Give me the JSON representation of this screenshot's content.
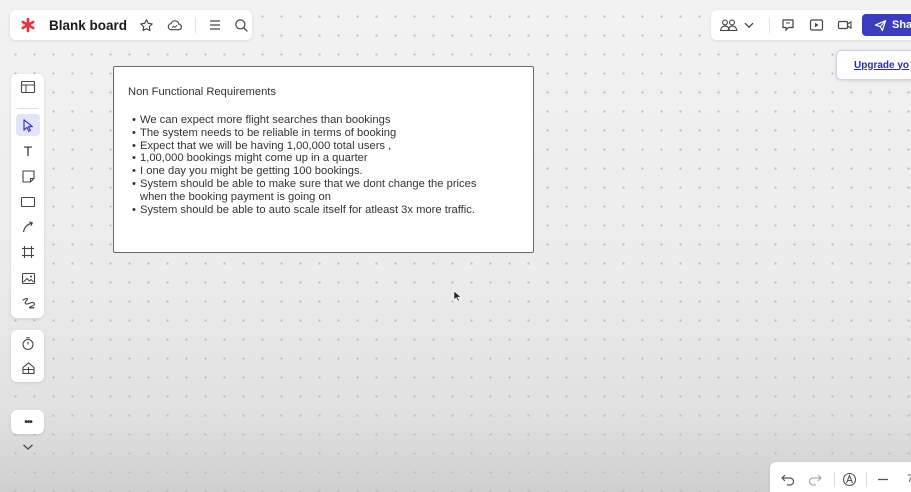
{
  "board": {
    "title": "Blank board",
    "icons": [
      "miro-logo",
      "star-icon",
      "cloud-icon",
      "menu-icon",
      "search-icon"
    ]
  },
  "collab": {
    "icons": [
      "people-icon",
      "chevron-down-icon",
      "comment-icon",
      "present-icon",
      "video-icon"
    ],
    "share_label": "Sha",
    "upgrade_label": "Upgrade yo"
  },
  "toolbar": {
    "tools": [
      "templates-icon",
      "select-icon",
      "text-icon",
      "sticky-note-icon",
      "shape-icon",
      "connection-line-icon",
      "frame-icon",
      "image-icon",
      "pen-icon",
      "timer-icon",
      "apps-icon",
      "more-icon",
      "chevron-down-icon"
    ],
    "text_tool_glyph": "T",
    "more_glyph": "•••"
  },
  "card": {
    "title": "Non Functional Requirements",
    "items": [
      "We can expect more flight searches than bookings",
      "The system needs to be reliable in terms of booking",
      "Expect that we will be having 1,00,000 total users ,",
      "1,00,000 bookings might come up in a quarter",
      "I one day you might be getting 100 bookings.",
      "System should be able to make sure that we dont change the prices when the booking payment is going on",
      "System should be able to auto scale itself for atleast 3x more traffic."
    ]
  },
  "bottom": {
    "icons": [
      "undo-icon",
      "redo-icon",
      "accessibility-icon",
      "zoom-out-icon"
    ],
    "zoom_partial": "7"
  },
  "colors": {
    "accent": "#3b3dbf",
    "logo": "#e8313f",
    "active_tool": "#e3e4fb"
  }
}
